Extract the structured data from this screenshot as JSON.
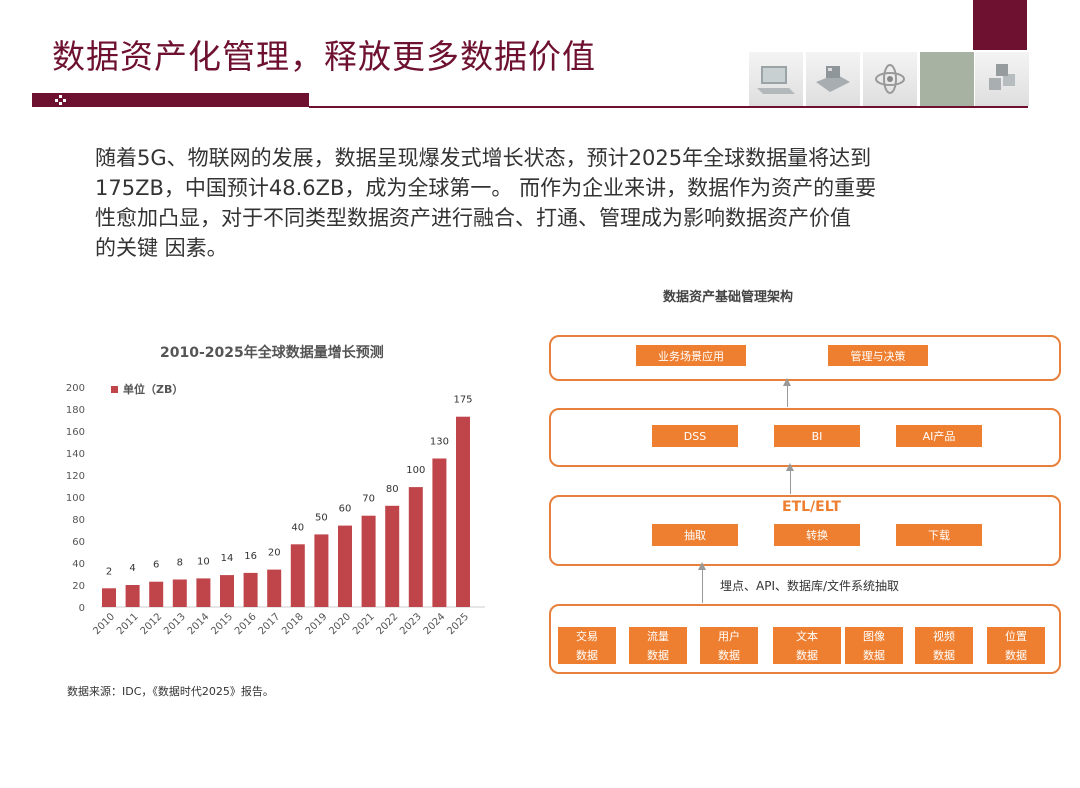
{
  "header": {
    "title": "数据资产化管理，释放更多数据价值"
  },
  "intro": {
    "lines": [
      "随着5G、物联网的发展，数据呈现爆发式增长状态，预计2025年全球数据量将达到",
      "175ZB，中国预计48.6ZB，成为全球第一。  而作为企业来讲，数据作为资产的重要",
      "性愈加凸显，对于不同类型数据资产进行融合、打通、管理成为影响数据资产价值",
      "的关键 因素。"
    ]
  },
  "chart_data": {
    "type": "bar",
    "title": "2010-2025年全球数据量增长预测",
    "xlabel": "",
    "ylabel": "",
    "categories": [
      "2010",
      "2011",
      "2012",
      "2013",
      "2014",
      "2015",
      "2016",
      "2017",
      "2018",
      "2019",
      "2020",
      "2021",
      "2022",
      "2023",
      "2024",
      "2025"
    ],
    "series": [
      {
        "name": "单位（ZB）",
        "values": [
          17,
          20,
          23,
          25,
          26,
          29,
          31,
          34,
          57,
          66,
          74,
          83,
          92,
          109,
          135,
          173
        ],
        "data_labels": [
          "2",
          "4",
          "6",
          "8",
          "10",
          "14",
          "16",
          "20",
          "40",
          "50",
          "60",
          "70",
          "80",
          "100",
          "130",
          "175"
        ]
      }
    ],
    "ylim": [
      0,
      200
    ],
    "yticks": [
      "0",
      "20",
      "40",
      "60",
      "80",
      "100",
      "120",
      "140",
      "160",
      "180",
      "200"
    ],
    "legend": "top-left",
    "grid": false,
    "bar_color": "#c0454b"
  },
  "source_note": "数据来源：IDC，《数据时代2025》报告。",
  "architecture": {
    "title": "数据资产基础管理架构",
    "layer1": [
      "业务场景应用",
      "管理与决策"
    ],
    "layer2": [
      "DSS",
      "BI",
      "AI产品"
    ],
    "etl_label": "ETL/ELT",
    "layer3": [
      "抽取",
      "转换",
      "下载"
    ],
    "extract_note": "埋点、API、数据库/文件系统抽取",
    "layer4": [
      [
        "交易",
        "数据"
      ],
      [
        "流量",
        "数据"
      ],
      [
        "用户",
        "数据"
      ],
      [
        "文本",
        "数据"
      ],
      [
        "图像",
        "数据"
      ],
      [
        "视频",
        "数据"
      ],
      [
        "位置",
        "数据"
      ]
    ]
  },
  "colors": {
    "brand": "#6e1131",
    "accent_orange": "#ef7f30",
    "bar": "#c0454b"
  }
}
